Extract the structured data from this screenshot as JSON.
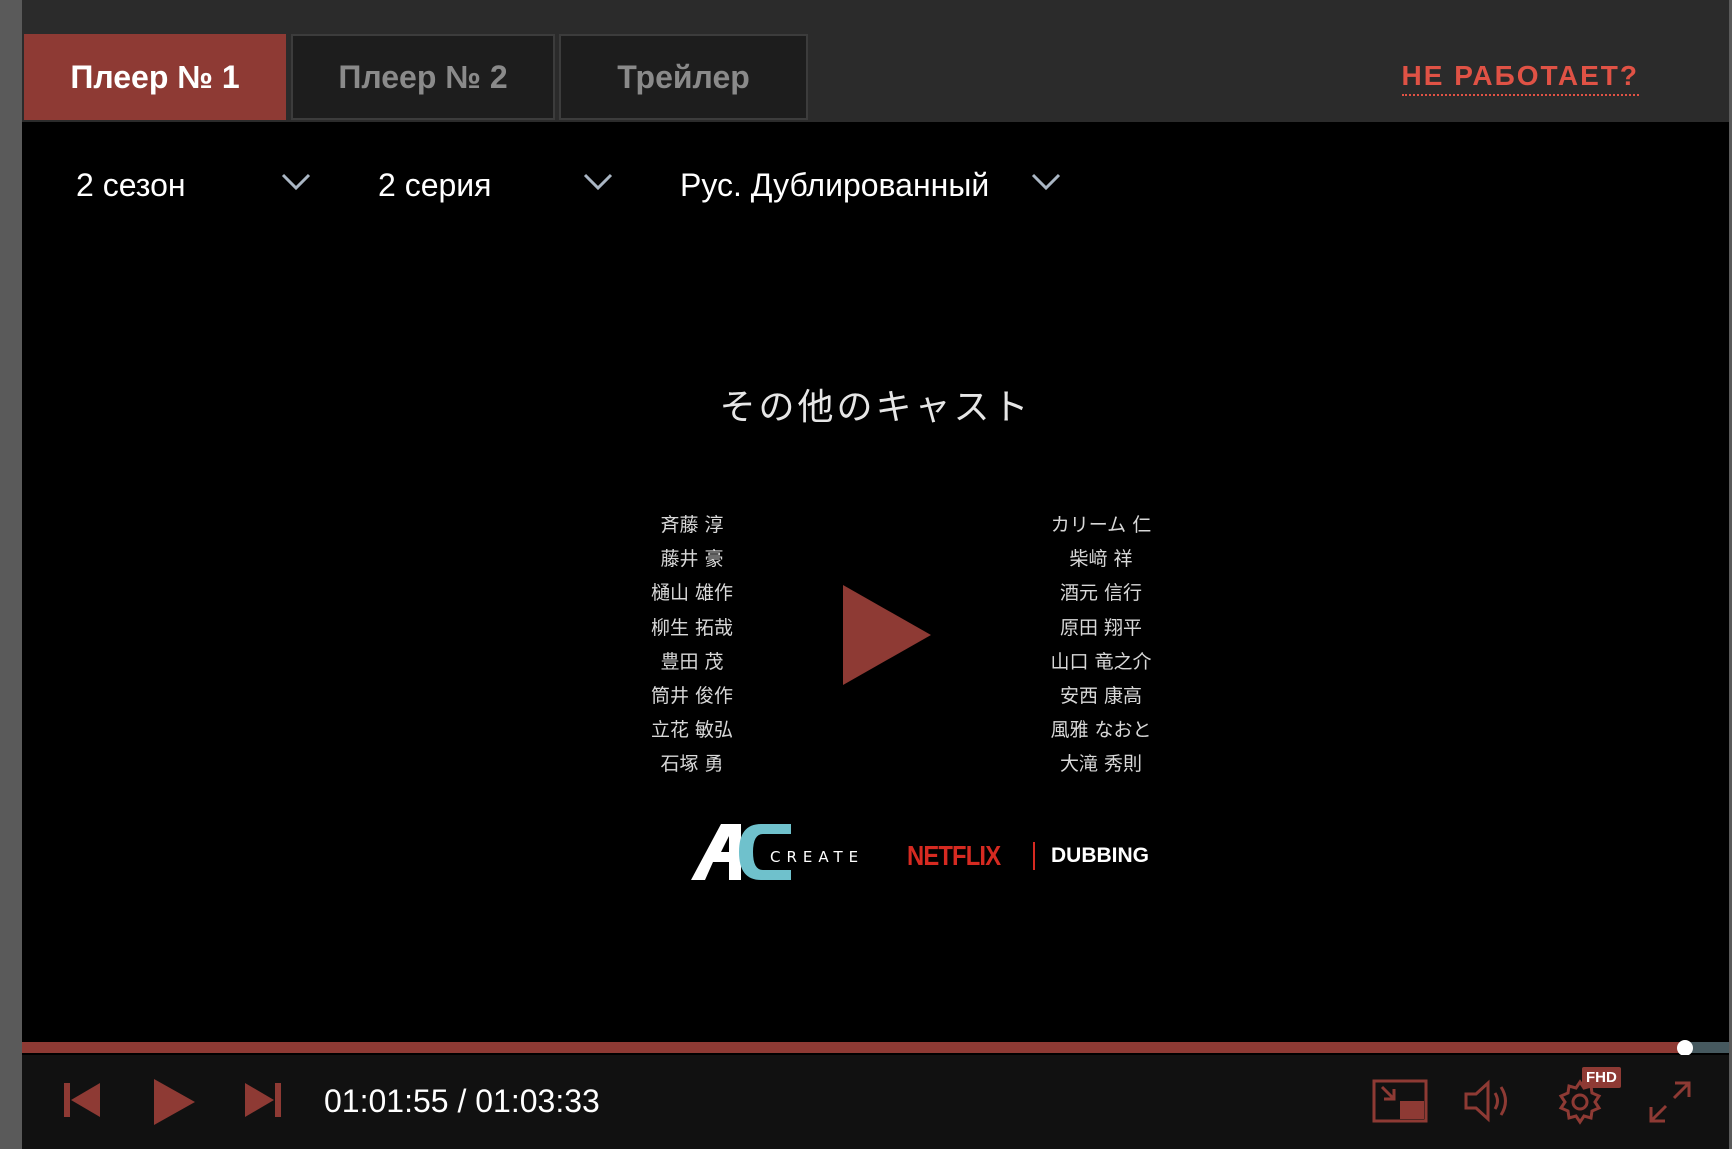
{
  "tabs": [
    {
      "label": "Плеер № 1",
      "active": true
    },
    {
      "label": "Плеер № 2",
      "active": false
    },
    {
      "label": "Трейлер",
      "active": false
    }
  ],
  "not_working_link": "НЕ РАБОТАЕТ?",
  "selectors": {
    "season": "2 сезон",
    "episode": "2 серия",
    "voiceover": "Рус. Дублированный"
  },
  "video": {
    "cast_title": "その他のキャスト",
    "cast_left": [
      "斉藤 淳",
      "藤井 豪",
      "樋山 雄作",
      "柳生 拓哉",
      "豊田 茂",
      "筒井 俊作",
      "立花 敏弘",
      "石塚 勇"
    ],
    "cast_right": [
      "カリーム 仁",
      "柴﨑 祥",
      "酒元 信行",
      "原田 翔平",
      "山口 竜之介",
      "安西 康高",
      "風雅 なおと",
      "大滝 秀則"
    ],
    "ac_logo_text": "CREATE",
    "netflix_text": "NETFLIX",
    "dubbing_text": "DUBBING"
  },
  "playback": {
    "time_display": "01:01:55 / 01:03:33",
    "progress_fraction": 0.9743,
    "quality_badge": "FHD"
  },
  "colors": {
    "accent": "#8e3a34",
    "link": "#e05245",
    "netflix_red": "#d62a21",
    "ac_teal": "#6fc1cc"
  },
  "icons": {
    "prev": "skip-previous-icon",
    "play": "play-icon",
    "next": "skip-next-icon",
    "pip": "picture-in-picture-icon",
    "volume": "volume-icon",
    "settings": "settings-gear-icon",
    "fullscreen": "fullscreen-icon",
    "dropdown": "chevron-down-icon"
  }
}
